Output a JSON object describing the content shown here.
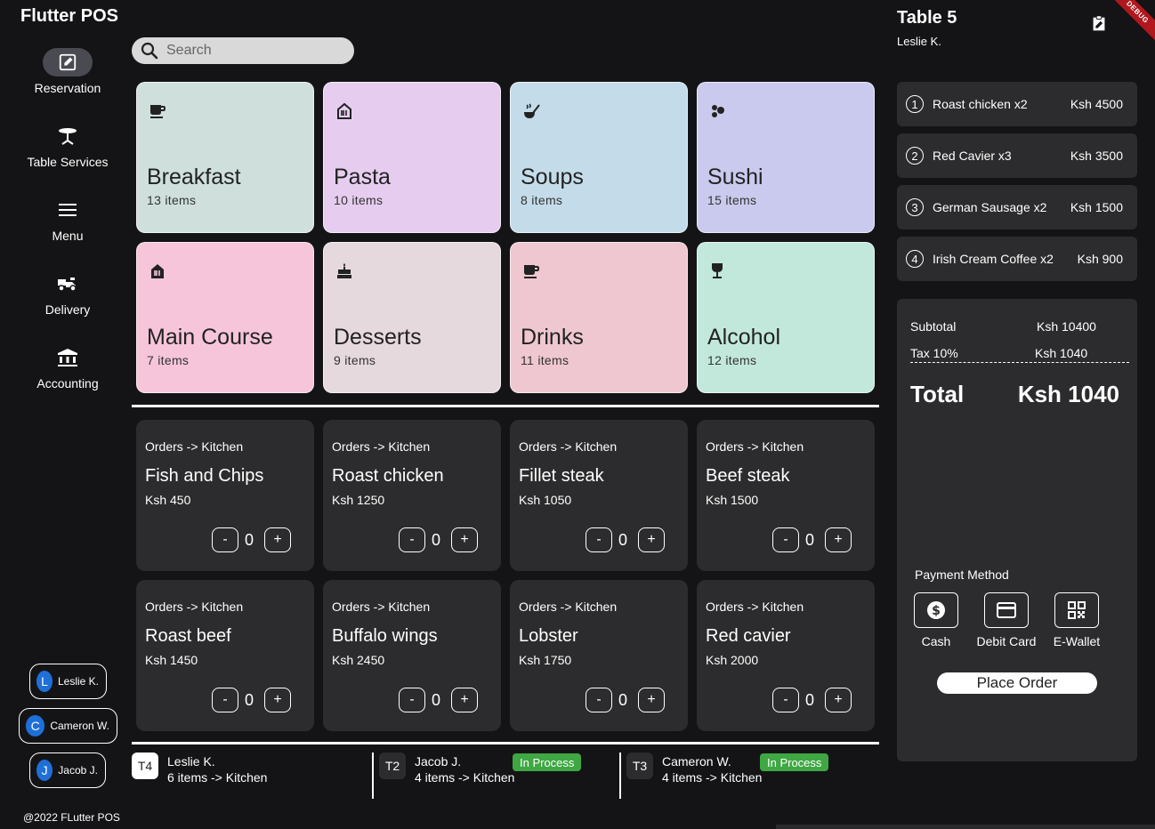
{
  "app": {
    "title": "Flutter POS",
    "copyright": "@2022 FLutter POS"
  },
  "sidebar": {
    "items": [
      {
        "label": "Reservation",
        "icon": "edit-note-icon",
        "active": true
      },
      {
        "label": "Table Services",
        "icon": "table-icon",
        "active": false
      },
      {
        "label": "Menu",
        "icon": "menu-icon",
        "active": false
      },
      {
        "label": "Delivery",
        "icon": "delivery-icon",
        "active": false
      },
      {
        "label": "Accounting",
        "icon": "bank-icon",
        "active": false
      }
    ],
    "users": [
      {
        "initial": "L",
        "name": "Leslie K."
      },
      {
        "initial": "C",
        "name": "Cameron W."
      },
      {
        "initial": "J",
        "name": "Jacob J."
      }
    ]
  },
  "search": {
    "placeholder": "Search",
    "value": ""
  },
  "categories": [
    {
      "name": "Breakfast",
      "count": "13 items",
      "color": "#cfe0dc",
      "icon": "coffee-icon"
    },
    {
      "name": "Pasta",
      "count": "10 items",
      "color": "#e6cdef",
      "icon": "restaurant-icon"
    },
    {
      "name": "Soups",
      "count": "8 items",
      "color": "#c4dce9",
      "icon": "soup-icon"
    },
    {
      "name": "Sushi",
      "count": "15 items",
      "color": "#cacaee",
      "icon": "sushi-icon"
    },
    {
      "name": "Main Course",
      "count": "7 items",
      "color": "#f6c5da",
      "icon": "restaurant-icon"
    },
    {
      "name": "Desserts",
      "count": "9 items",
      "color": "#e6d9de",
      "icon": "cake-icon"
    },
    {
      "name": "Drinks",
      "count": "11 items",
      "color": "#efc7d0",
      "icon": "coffee-icon"
    },
    {
      "name": "Alcohol",
      "count": "12 items",
      "color": "#c2e8dc",
      "icon": "wine-icon"
    }
  ],
  "items": [
    {
      "route": "Orders -> Kitchen",
      "name": "Fish and Chips",
      "price": "Ksh 450",
      "qty": "0"
    },
    {
      "route": "Orders -> Kitchen",
      "name": "Roast chicken",
      "price": "Ksh 1250",
      "qty": "0"
    },
    {
      "route": "Orders -> Kitchen",
      "name": "Fillet steak",
      "price": "Ksh 1050",
      "qty": "0"
    },
    {
      "route": "Orders -> Kitchen",
      "name": "Beef steak",
      "price": "Ksh 1500",
      "qty": "0"
    },
    {
      "route": "Orders -> Kitchen",
      "name": "Roast beef",
      "price": "Ksh 1450",
      "qty": "0"
    },
    {
      "route": "Orders -> Kitchen",
      "name": "Buffalo wings",
      "price": "Ksh 2450",
      "qty": "0"
    },
    {
      "route": "Orders -> Kitchen",
      "name": "Lobster",
      "price": "Ksh 1750",
      "qty": "0"
    },
    {
      "route": "Orders -> Kitchen",
      "name": "Red cavier",
      "price": "Ksh 2000",
      "qty": "0"
    }
  ],
  "qty_controls": {
    "minus": "-",
    "plus": "+"
  },
  "active_orders": [
    {
      "table": "T4",
      "name": "Leslie K.",
      "detail": "6 items -> Kitchen",
      "status": "",
      "tag_bg": "#ffffff",
      "tag_fg": "#222222"
    },
    {
      "table": "T2",
      "name": "Jacob J.",
      "detail": "4 items -> Kitchen",
      "status": "In Process",
      "tag_bg": "#2c2c2e",
      "tag_fg": "#ffffff"
    },
    {
      "table": "T3",
      "name": "Cameron W.",
      "detail": "4 items -> Kitchen",
      "status": "In Process",
      "tag_bg": "#2c2c2e",
      "tag_fg": "#ffffff"
    }
  ],
  "order_panel": {
    "title": "Table 5",
    "server": "Leslie K.",
    "debug": "DEBUG",
    "lines": [
      {
        "num": "1",
        "desc": "Roast chicken x2",
        "price": "Ksh 4500"
      },
      {
        "num": "2",
        "desc": "Red Cavier x3",
        "price": "Ksh 3500"
      },
      {
        "num": "3",
        "desc": "German Sausage x2",
        "price": "Ksh 1500"
      },
      {
        "num": "4",
        "desc": "Irish Cream Coffee x2",
        "price": "Ksh 900"
      }
    ],
    "subtotal_label": "Subtotal",
    "subtotal_value": "Ksh 10400",
    "tax_label": "Tax 10%",
    "tax_value": "Ksh 1040",
    "total_label": "Total",
    "total_value": "Ksh 1040",
    "payment_label": "Payment Method",
    "payment_methods": [
      {
        "label": "Cash",
        "icon": "dollar-icon"
      },
      {
        "label": "Debit Card",
        "icon": "credit-card-icon"
      },
      {
        "label": "E-Wallet",
        "icon": "qr-code-icon"
      }
    ],
    "place_order": "Place Order"
  }
}
